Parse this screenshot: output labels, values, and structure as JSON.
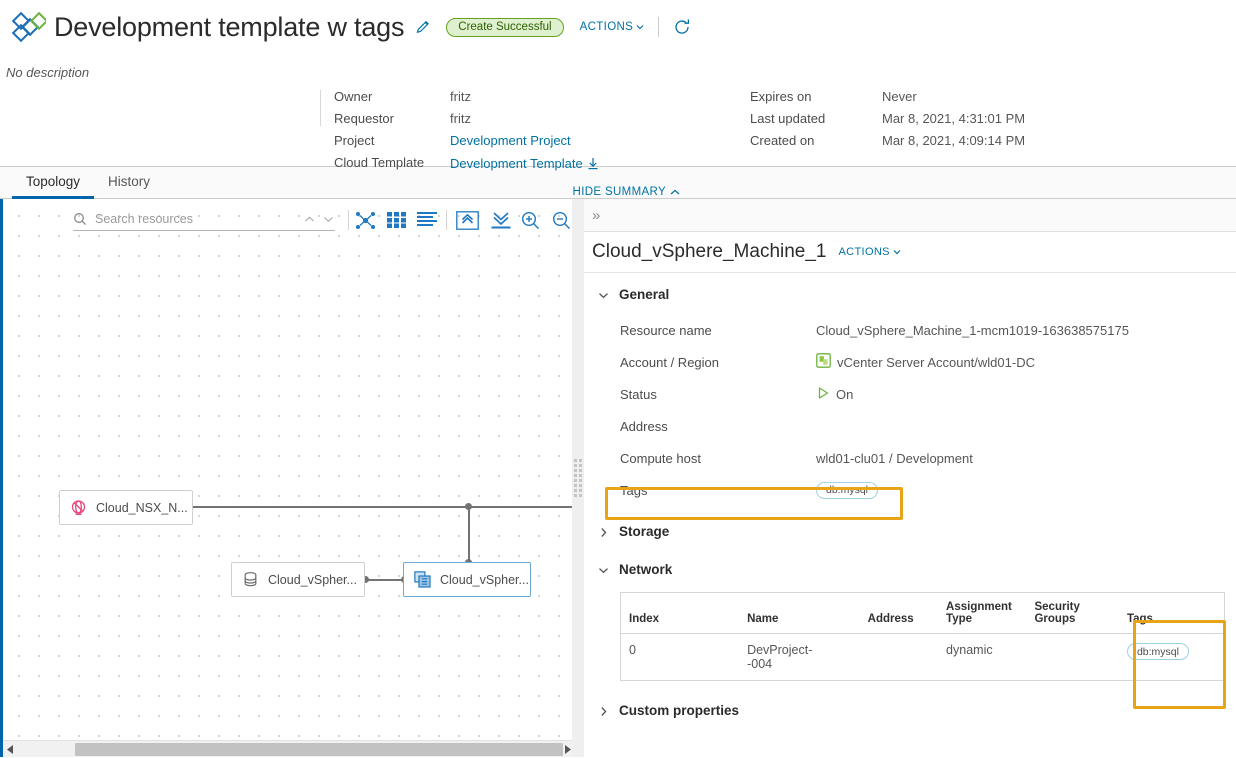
{
  "header": {
    "logo_icon": "vmware-diamond-logo-icon",
    "title": "Development template w tags",
    "edit_icon": "pencil-icon",
    "status_badge": "Create Successful",
    "actions_label": "ACTIONS",
    "refresh_icon": "refresh-icon",
    "description": "No description",
    "hide_summary_label": "HIDE SUMMARY",
    "summary_left": [
      {
        "key": "Owner",
        "value": "fritz",
        "link": false
      },
      {
        "key": "Requestor",
        "value": "fritz",
        "link": false
      },
      {
        "key": "Project",
        "value": "Development Project",
        "link": true
      },
      {
        "key": "Cloud Template",
        "value": "Development Template",
        "link": true,
        "download_icon": "download-icon"
      }
    ],
    "summary_right": [
      {
        "key": "Expires on",
        "value": "Never"
      },
      {
        "key": "Last updated",
        "value": "Mar 8, 2021, 4:31:01 PM"
      },
      {
        "key": "Created on",
        "value": "Mar 8, 2021, 4:09:14 PM"
      }
    ]
  },
  "tabs": [
    {
      "label": "Topology",
      "active": true
    },
    {
      "label": "History",
      "active": false
    }
  ],
  "topology": {
    "search": {
      "placeholder": "Search resources",
      "value": ""
    },
    "toolbar_icons": [
      "topology-graph-icon",
      "grid-view-icon",
      "list-view-icon",
      "expand-all-icon",
      "collapse-all-icon",
      "zoom-in-icon",
      "zoom-out-icon"
    ],
    "nav_up_icon": "chevron-up-icon",
    "nav_down_icon": "chevron-down-icon",
    "nodes": [
      {
        "label": "Cloud_NSX_N...",
        "icon": "nsx-network-icon",
        "selected": false
      },
      {
        "label": "Cloud_vSpher...",
        "icon": "disk-storage-icon",
        "selected": false
      },
      {
        "label": "Cloud_vSpher...",
        "icon": "vsphere-machine-icon",
        "selected": true
      }
    ],
    "scroll_left_icon": "scroll-left-arrow-icon",
    "scroll_right_icon": "scroll-right-arrow-icon"
  },
  "detail": {
    "collapse_icon": "double-chevron-right-icon",
    "title": "Cloud_vSphere_Machine_1",
    "actions_label": "ACTIONS",
    "sections": [
      {
        "name": "General",
        "expanded": true
      },
      {
        "name": "Storage",
        "expanded": false
      },
      {
        "name": "Network",
        "expanded": true
      },
      {
        "name": "Custom properties",
        "expanded": false
      }
    ],
    "general": [
      {
        "key": "Resource name",
        "value": "Cloud_vSphere_Machine_1-mcm1019-163638575175",
        "icon": null
      },
      {
        "key": "Account / Region",
        "value": "vCenter Server Account/wld01-DC",
        "icon": "vcenter-account-icon"
      },
      {
        "key": "Status",
        "value": "On",
        "icon": "power-on-icon"
      },
      {
        "key": "Address",
        "value": "",
        "icon": null
      },
      {
        "key": "Compute host",
        "value": "wld01-clu01 / Development",
        "icon": null
      },
      {
        "key": "Tags",
        "value": "",
        "icon": null,
        "tag": "db:mysql",
        "highlighted": true
      }
    ],
    "network_table": {
      "columns": [
        "Index",
        "Name",
        "Address",
        "Assignment Type",
        "Security Groups",
        "Tags"
      ],
      "rows": [
        {
          "index": "0",
          "name": "DevProject--004",
          "address": "",
          "assignment_type": "dynamic",
          "security_groups": "",
          "tags": "db:mysql"
        }
      ],
      "highlighted_column": "Tags"
    }
  },
  "colors": {
    "accent_blue": "#0072a3",
    "tab_underline": "#0065ab",
    "highlight_orange": "#e8a317",
    "badge_green_border": "#62a420",
    "badge_green_bg": "#dff0d0",
    "nsx_pink": "#e8467c",
    "logo_blue": "#1d6fb8",
    "logo_green": "#6db33f"
  }
}
